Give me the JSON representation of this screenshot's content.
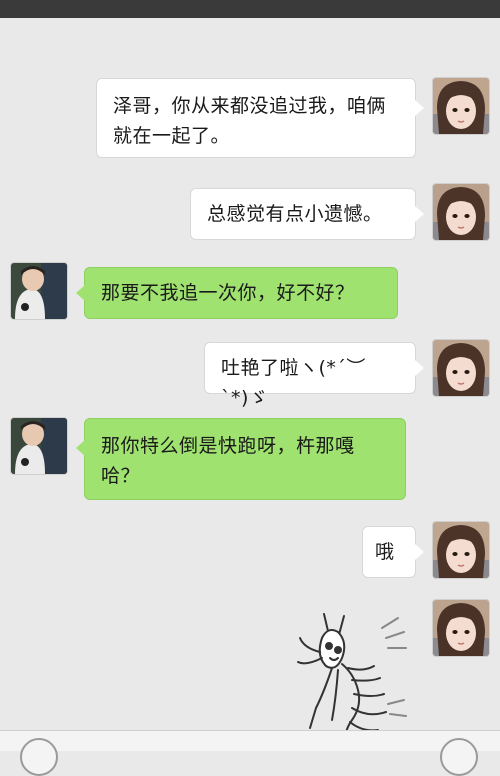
{
  "messages": [
    {
      "side": "right",
      "sender": "girl",
      "text": "泽哥，你从来都没追过我，咱俩就在一起了。"
    },
    {
      "side": "right",
      "sender": "girl",
      "text": "总感觉有点小遗憾。"
    },
    {
      "side": "left",
      "sender": "boy",
      "text": "那要不我追一次你，好不好？"
    },
    {
      "side": "right",
      "sender": "girl",
      "text": "吐艳了啦ヽ(*´︶`*)ゞ"
    },
    {
      "side": "left",
      "sender": "boy",
      "text": "那你特么倒是快跑呀，杵那嘎哈？"
    },
    {
      "side": "right",
      "sender": "girl",
      "text": "哦"
    },
    {
      "side": "right",
      "sender": "girl",
      "sticker": "running-crayfish-sticker"
    }
  ],
  "colors": {
    "background": "#e9e9e9",
    "bubble_self": "#ffffff",
    "bubble_other": "#9fe26f"
  },
  "icons": [
    "voice-toggle-icon",
    "emoji-icon"
  ]
}
